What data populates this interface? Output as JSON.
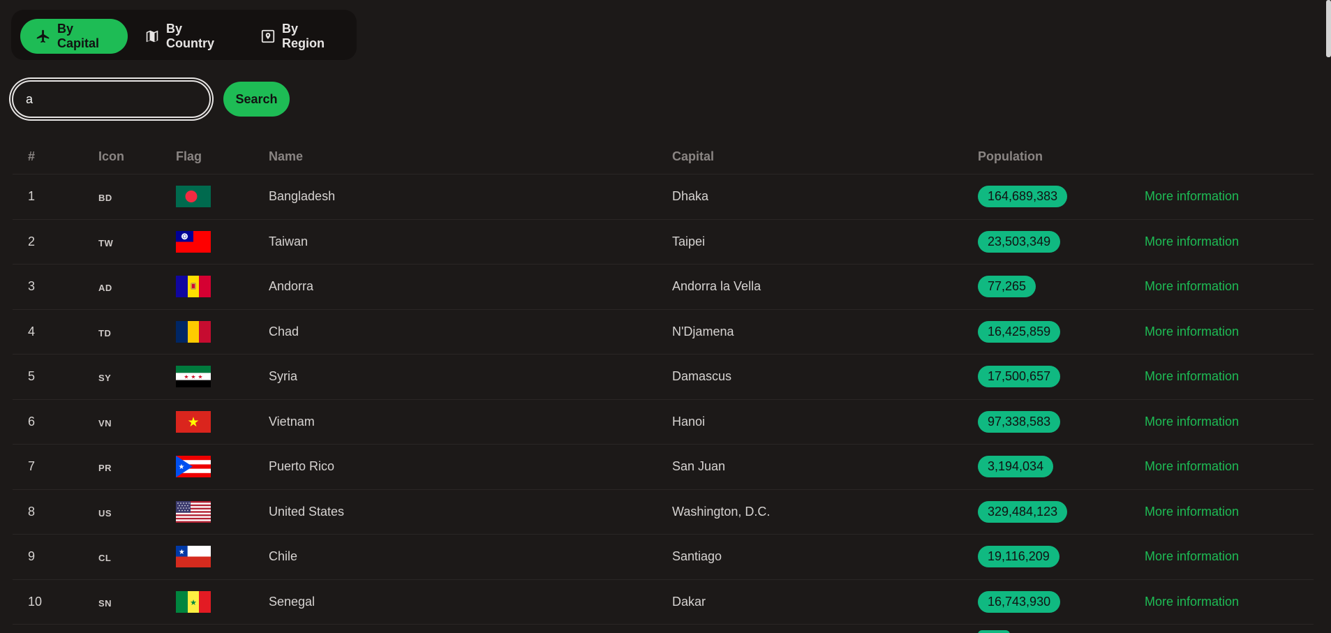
{
  "tabs": [
    {
      "label": "By Capital",
      "icon": "airplane-icon"
    },
    {
      "label": "By Country",
      "icon": "map-icon"
    },
    {
      "label": "By Region",
      "icon": "location-pin-icon"
    }
  ],
  "search": {
    "value": "a",
    "button_label": "Search"
  },
  "table": {
    "headers": {
      "num": "#",
      "icon": "Icon",
      "flag": "Flag",
      "name": "Name",
      "capital": "Capital",
      "population": "Population"
    },
    "link_label": "More information",
    "rows": [
      {
        "num": "1",
        "code": "BD",
        "name": "Bangladesh",
        "capital": "Dhaka",
        "population": "164,689,383"
      },
      {
        "num": "2",
        "code": "TW",
        "name": "Taiwan",
        "capital": "Taipei",
        "population": "23,503,349"
      },
      {
        "num": "3",
        "code": "AD",
        "name": "Andorra",
        "capital": "Andorra la Vella",
        "population": "77,265"
      },
      {
        "num": "4",
        "code": "TD",
        "name": "Chad",
        "capital": "N'Djamena",
        "population": "16,425,859"
      },
      {
        "num": "5",
        "code": "SY",
        "name": "Syria",
        "capital": "Damascus",
        "population": "17,500,657"
      },
      {
        "num": "6",
        "code": "VN",
        "name": "Vietnam",
        "capital": "Hanoi",
        "population": "97,338,583"
      },
      {
        "num": "7",
        "code": "PR",
        "name": "Puerto Rico",
        "capital": "San Juan",
        "population": "3,194,034"
      },
      {
        "num": "8",
        "code": "US",
        "name": "United States",
        "capital": "Washington, D.C.",
        "population": "329,484,123"
      },
      {
        "num": "9",
        "code": "CL",
        "name": "Chile",
        "capital": "Santiago",
        "population": "19,116,209"
      },
      {
        "num": "10",
        "code": "SN",
        "name": "Senegal",
        "capital": "Dakar",
        "population": "16,743,930"
      }
    ]
  },
  "colors": {
    "accent": "#1ebc55",
    "badge": "#10b981",
    "background": "#1c1918"
  }
}
